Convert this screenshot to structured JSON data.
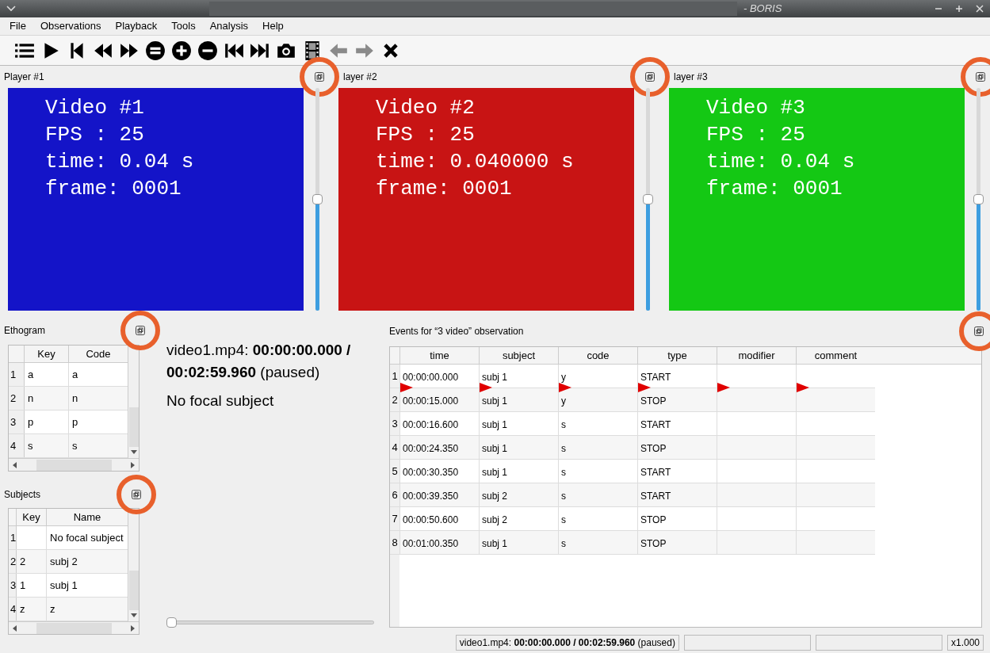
{
  "window": {
    "title": "- BORIS"
  },
  "menu": [
    "File",
    "Observations",
    "Playback",
    "Tools",
    "Analysis",
    "Help"
  ],
  "toolbar": [
    {
      "kind": "list",
      "disabled": false
    },
    {
      "kind": "play",
      "disabled": false
    },
    {
      "kind": "first",
      "disabled": false
    },
    {
      "kind": "rewind",
      "disabled": false
    },
    {
      "kind": "forward",
      "disabled": false
    },
    {
      "kind": "equal",
      "disabled": false
    },
    {
      "kind": "plus",
      "disabled": false
    },
    {
      "kind": "minus",
      "disabled": false
    },
    {
      "kind": "previous",
      "disabled": false
    },
    {
      "kind": "next",
      "disabled": false
    },
    {
      "kind": "camera",
      "disabled": false
    },
    {
      "kind": "film",
      "disabled": false
    },
    {
      "kind": "back",
      "disabled": true
    },
    {
      "kind": "ahead",
      "disabled": true
    },
    {
      "kind": "close",
      "disabled": false
    }
  ],
  "players": [
    {
      "title": "Player #1",
      "color": "#1414c8",
      "lines": [
        "Video #1",
        "FPS : 25",
        "time: 0.04 s",
        "frame: 0001"
      ],
      "level": 0.5,
      "highlighted": true
    },
    {
      "title": "layer #2",
      "color": "#c81414",
      "lines": [
        "Video #2",
        "FPS : 25",
        "time: 0.040000 s",
        "frame: 0001"
      ],
      "level": 0.5,
      "highlighted": true
    },
    {
      "title": "layer #3",
      "color": "#14c814",
      "lines": [
        "Video #3",
        "FPS : 25",
        "time: 0.04 s",
        "frame: 0001"
      ],
      "level": 0.5,
      "highlighted": true
    }
  ],
  "ethogram": {
    "title": "Ethogram",
    "highlighted": true,
    "columns": [
      "Key",
      "Code"
    ],
    "rows": [
      [
        "1",
        "a",
        "a"
      ],
      [
        "2",
        "n",
        "n"
      ],
      [
        "3",
        "p",
        "p"
      ],
      [
        "4",
        "s",
        "s"
      ]
    ]
  },
  "subjects": {
    "title": "Subjects",
    "highlighted": true,
    "columns": [
      "Key",
      "Name"
    ],
    "rows": [
      [
        "1",
        "",
        "No focal subject"
      ],
      [
        "2",
        "2",
        "subj 2"
      ],
      [
        "3",
        "1",
        "subj 1"
      ],
      [
        "4",
        "z",
        "z"
      ]
    ]
  },
  "info": {
    "time": "video1.mp4: **00:00:00.000 / 00:02:59.960** (paused)",
    "focal": "No focal subject",
    "level": 0
  },
  "events": {
    "title": "Events for “3 video” observation",
    "highlighted": true,
    "columns": [
      "time",
      "subject",
      "code",
      "type",
      "modifier",
      "comment"
    ],
    "rows": [
      {
        "n": "1",
        "cells": [
          "00:00:00.000",
          "subj 1",
          "y",
          "START",
          "",
          ""
        ],
        "flagged": true
      },
      {
        "n": "2",
        "cells": [
          "00:00:15.000",
          "subj 1",
          "y",
          "STOP",
          "",
          ""
        ],
        "flagged": false
      },
      {
        "n": "3",
        "cells": [
          "00:00:16.600",
          "subj 1",
          "s",
          "START",
          "",
          ""
        ],
        "flagged": false
      },
      {
        "n": "4",
        "cells": [
          "00:00:24.350",
          "subj 1",
          "s",
          "STOP",
          "",
          ""
        ],
        "flagged": false
      },
      {
        "n": "5",
        "cells": [
          "00:00:30.350",
          "subj 1",
          "s",
          "START",
          "",
          ""
        ],
        "flagged": false
      },
      {
        "n": "6",
        "cells": [
          "00:00:39.350",
          "subj 2",
          "s",
          "START",
          "",
          ""
        ],
        "flagged": false
      },
      {
        "n": "7",
        "cells": [
          "00:00:50.600",
          "subj 2",
          "s",
          "STOP",
          "",
          ""
        ],
        "flagged": false
      },
      {
        "n": "8",
        "cells": [
          "00:01:00.350",
          "subj 1",
          "s",
          "STOP",
          "",
          ""
        ],
        "flagged": false
      }
    ]
  },
  "status_bar": {
    "playback": "video1.mp4: **00:00:00.000 / 00:02:59.960** (paused)",
    "speed": "x1.000"
  }
}
